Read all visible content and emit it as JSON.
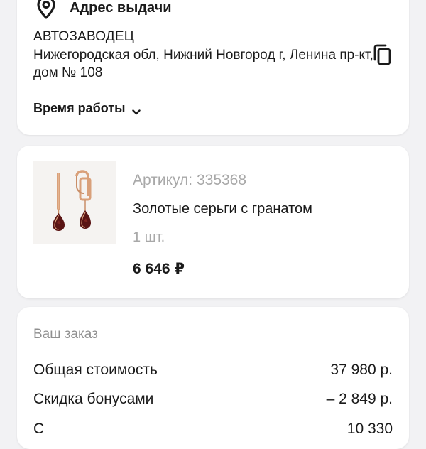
{
  "pickup": {
    "title": "Адрес выдачи",
    "store_name": "АВТОЗАВОДЕЦ",
    "address": "Нижегородская обл, Нижний Новгород г, Ленина пр-кт, дом № 108",
    "hours_label": "Время работы",
    "icons": [
      "location-pin-icon",
      "copy-icon",
      "chevron-down-icon"
    ]
  },
  "product": {
    "article": "Артикул: 335368",
    "name": "Золотые серьги с гранатом",
    "quantity": "1 шт.",
    "price": "6 646 ₽"
  },
  "order": {
    "title": "Ваш заказ",
    "rows": [
      {
        "label": "Общая стоимость",
        "value": "37 980 р."
      },
      {
        "label": "Скидка бонусами",
        "value": "– 2 849 р."
      },
      {
        "label": "С",
        "value": "10 330"
      }
    ]
  },
  "colors": {
    "background": "#f2f2f4",
    "card": "#ffffff",
    "text": "#1a1a1a",
    "muted": "#a8a8a8",
    "gold": "#d9a07a",
    "garnet": "#5a1414"
  }
}
